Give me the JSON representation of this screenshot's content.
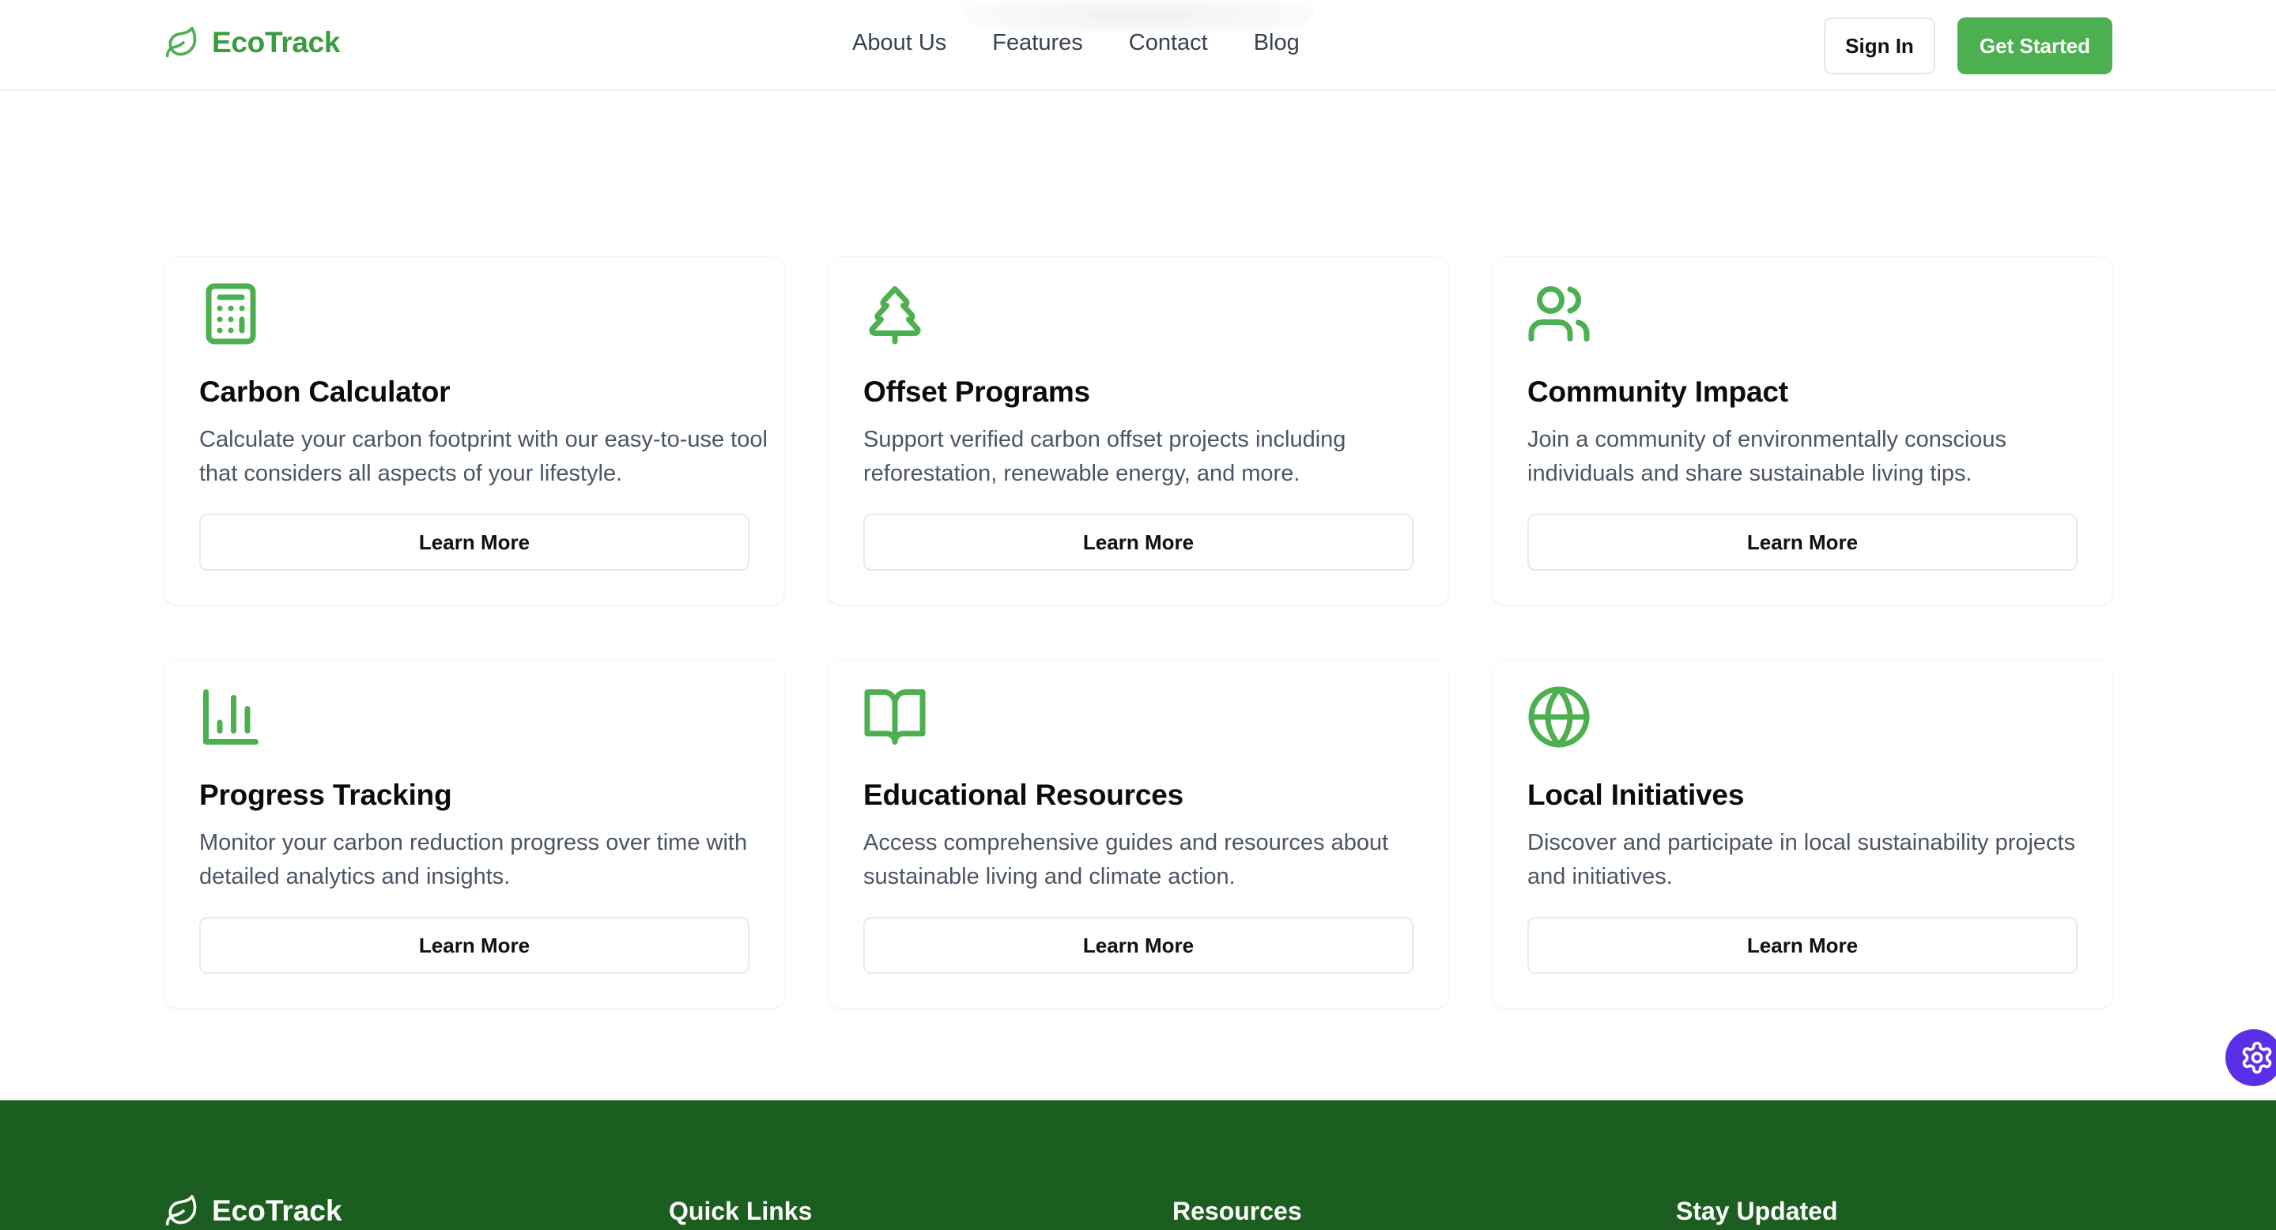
{
  "header": {
    "logo_text": "EcoTrack",
    "nav": [
      "About Us",
      "Features",
      "Contact",
      "Blog"
    ],
    "sign_in": "Sign In",
    "get_started": "Get Started"
  },
  "features": [
    {
      "icon": "calculator-icon",
      "title": "Carbon Calculator",
      "desc": "Calculate your carbon footprint with our easy-to-use tool that considers all aspects of your lifestyle.",
      "button": "Learn More"
    },
    {
      "icon": "tree-icon",
      "title": "Offset Programs",
      "desc": "Support verified carbon offset projects including reforestation, renewable energy, and more.",
      "button": "Learn More"
    },
    {
      "icon": "users-icon",
      "title": "Community Impact",
      "desc": "Join a community of environmentally conscious individuals and share sustainable living tips.",
      "button": "Learn More"
    },
    {
      "icon": "bar-chart-icon",
      "title": "Progress Tracking",
      "desc": "Monitor your carbon reduction progress over time with detailed analytics and insights.",
      "button": "Learn More"
    },
    {
      "icon": "book-open-icon",
      "title": "Educational Resources",
      "desc": "Access comprehensive guides and resources about sustainable living and climate action.",
      "button": "Learn More"
    },
    {
      "icon": "globe-icon",
      "title": "Local Initiatives",
      "desc": "Discover and participate in local sustainability projects and initiatives.",
      "button": "Learn More"
    }
  ],
  "footer": {
    "logo_text": "EcoTrack",
    "headings": [
      "Quick Links",
      "Resources",
      "Stay Updated"
    ]
  },
  "colors": {
    "brand_green": "#4caf50",
    "logo_green": "#3a9b3f",
    "footer_green": "#1b5e20",
    "fab_purple": "#5b2ee8"
  }
}
